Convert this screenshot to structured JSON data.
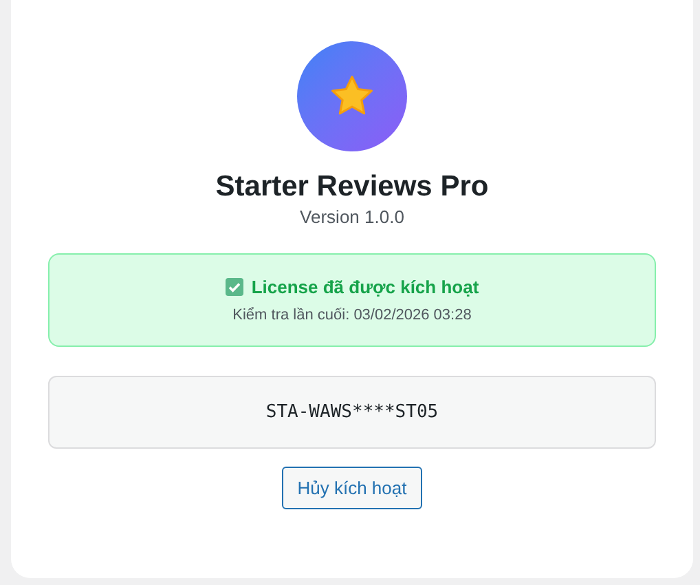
{
  "app": {
    "name": "Starter Reviews Pro",
    "version": "Version 1.0.0"
  },
  "license": {
    "active": true,
    "status": "License đã được kích hoạt",
    "last_checked": "Kiểm tra lần cuối: 03/02/2026 03:28",
    "key": "STA-WAWS****ST05"
  },
  "buttons": [
    "Hủy kích hoạt"
  ]
}
